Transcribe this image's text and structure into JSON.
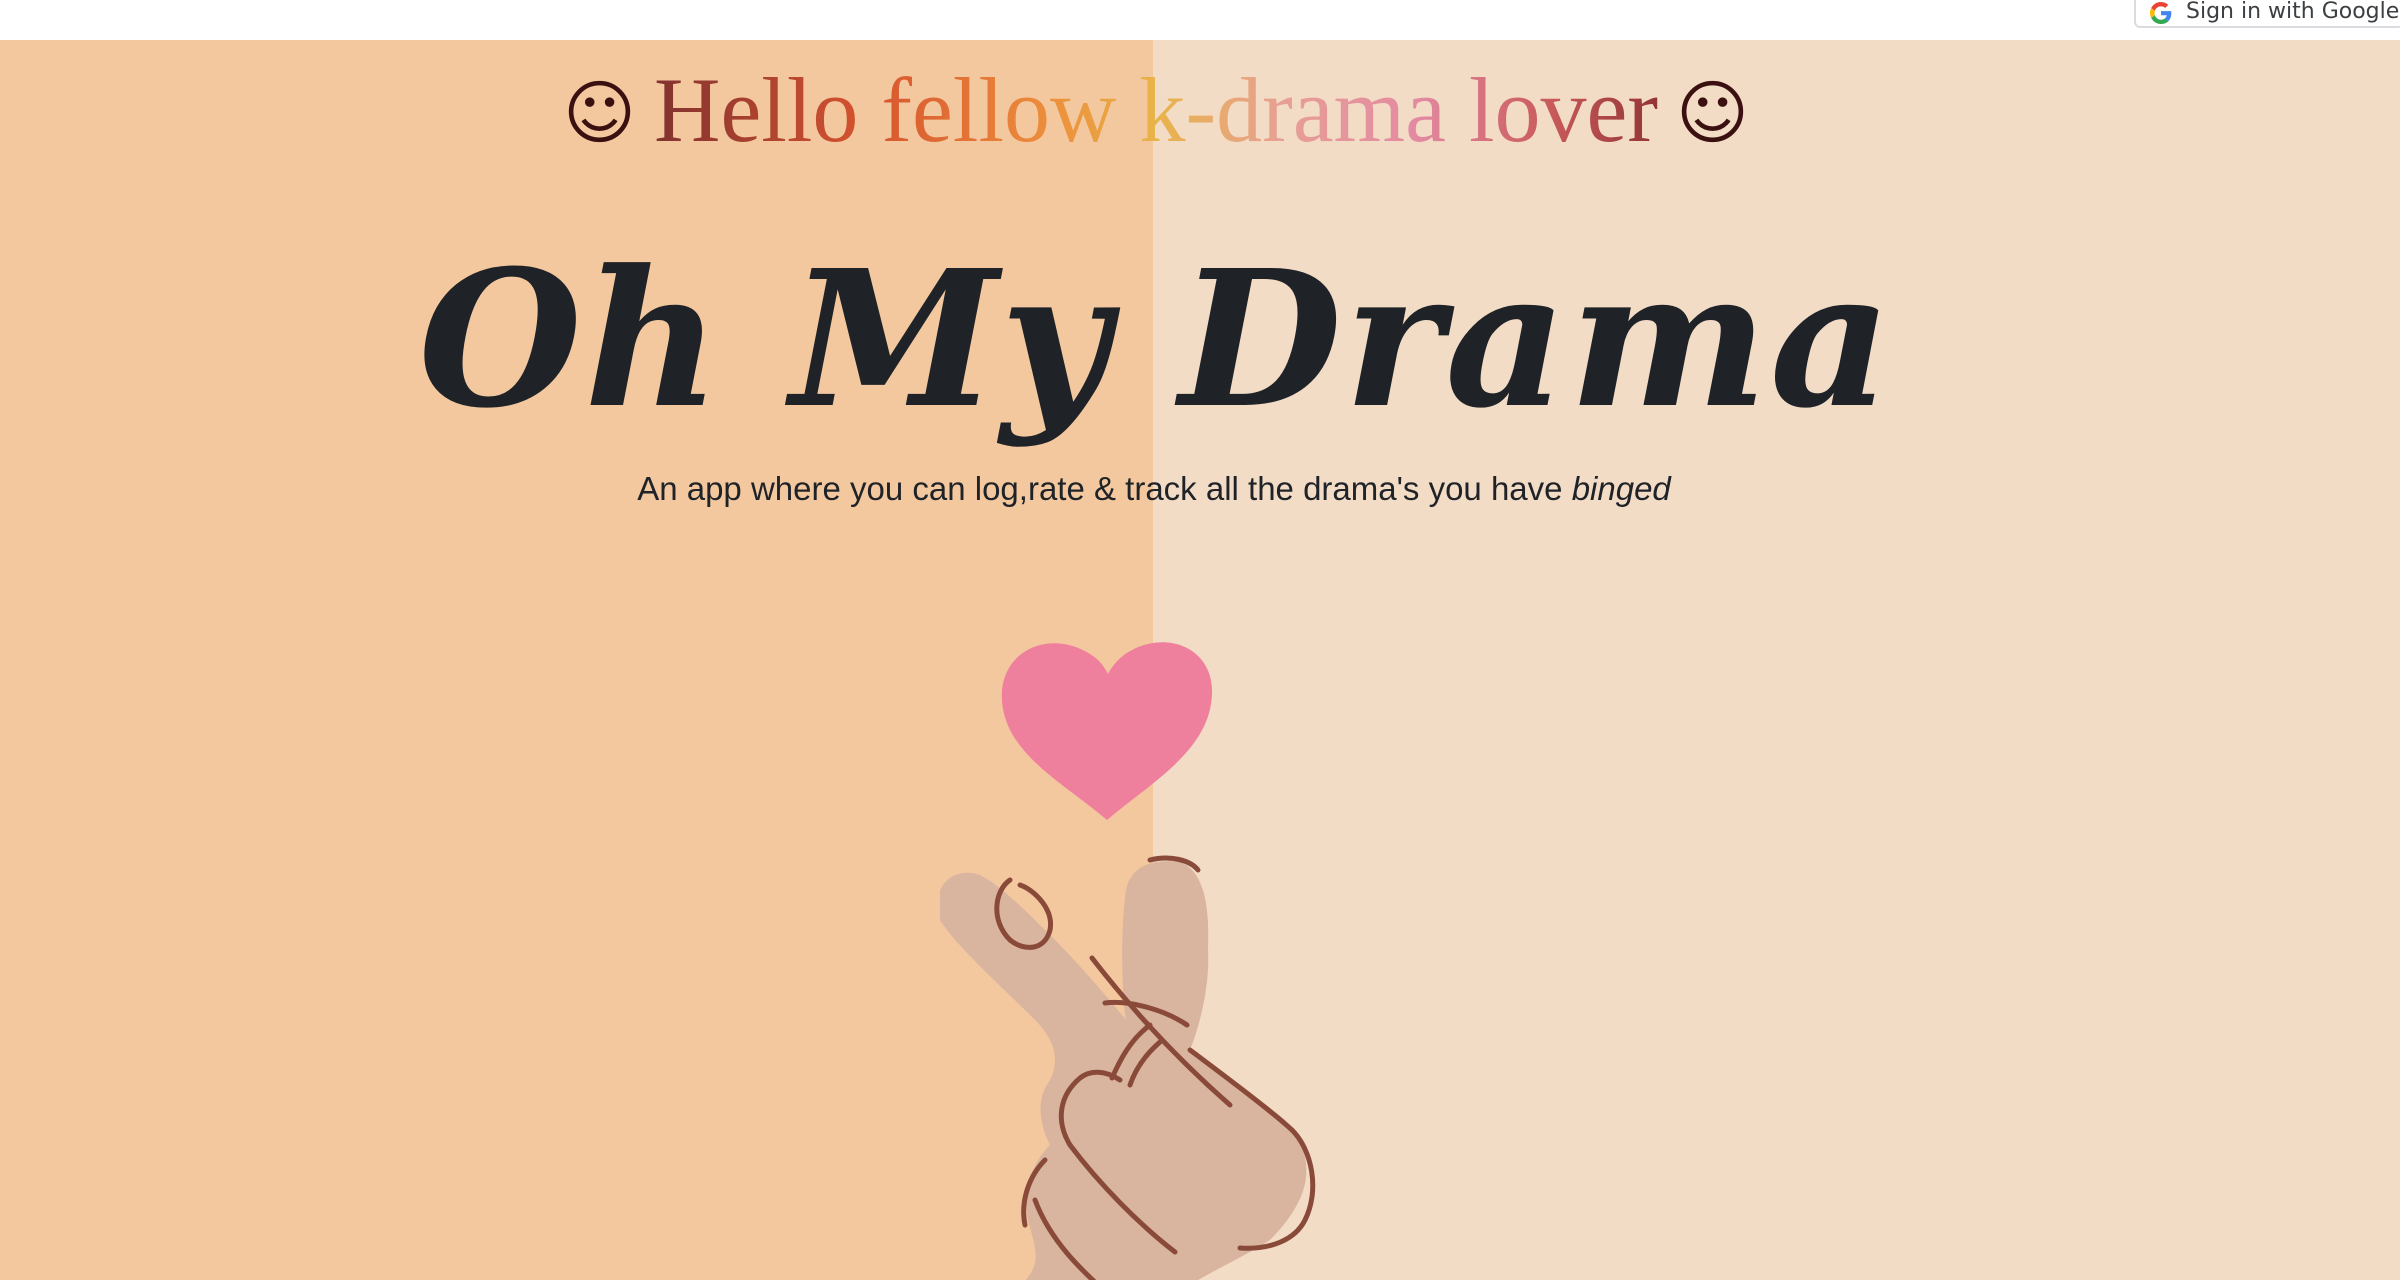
{
  "auth": {
    "google_signin_label": "Sign in with Google"
  },
  "hero": {
    "smiley": "☺",
    "greeting": "Hello fellow k-drama lover",
    "title": "Oh My Drama",
    "tagline_main": "An app where you can log,rate & track all the drama's you have ",
    "tagline_emphasis": "binged"
  },
  "colors": {
    "left_panel": "#f4c89f",
    "right_panel": "#f3dcc6",
    "title_text": "#1f2328",
    "heart": "#ee7f9d",
    "hand": "#d9b5a0",
    "hand_outline": "#8a4a3a"
  },
  "icons": {
    "google": "google-g-icon",
    "smiley": "smiley-icon",
    "heart": "heart-icon",
    "hand": "finger-heart-hand-icon"
  }
}
